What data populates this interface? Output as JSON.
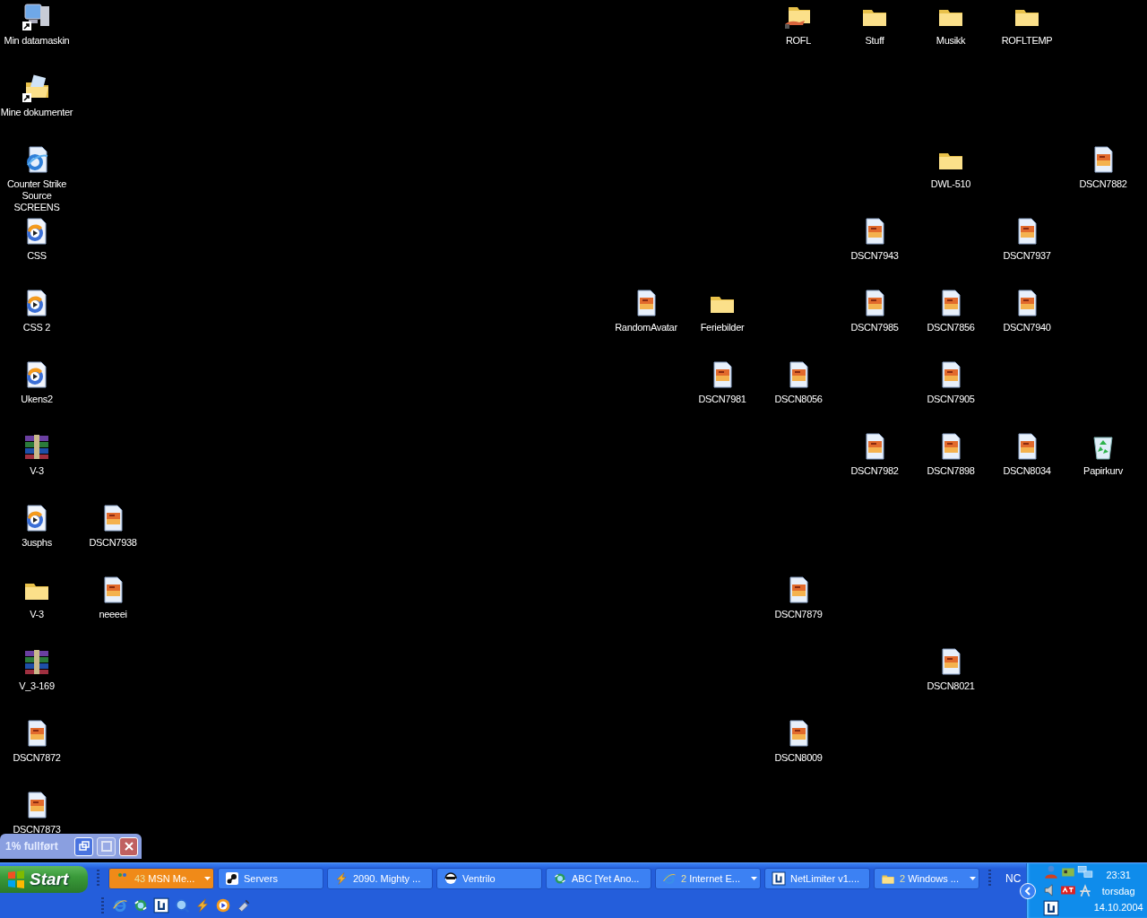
{
  "desktop_icons": [
    {
      "label": "Min datamaskin",
      "kind": "computer",
      "shortcut": true
    },
    {
      "label": "ROFL",
      "kind": "shared-folder",
      "shortcut": false
    },
    {
      "label": "Stuff",
      "kind": "folder",
      "shortcut": false
    },
    {
      "label": "Musikk",
      "kind": "folder",
      "shortcut": false
    },
    {
      "label": "ROFLTEMP",
      "kind": "folder",
      "shortcut": false
    },
    {
      "label": "Mine dokumenter",
      "kind": "documents",
      "shortcut": true
    },
    {
      "label": "Counter Strike Source SCREENS",
      "kind": "web",
      "shortcut": false
    },
    {
      "label": "DWL-510",
      "kind": "folder",
      "shortcut": false
    },
    {
      "label": "DSCN7882",
      "kind": "image",
      "shortcut": false
    },
    {
      "label": "CSS",
      "kind": "media",
      "shortcut": false
    },
    {
      "label": "DSCN7943",
      "kind": "image",
      "shortcut": false
    },
    {
      "label": "DSCN7937",
      "kind": "image",
      "shortcut": false
    },
    {
      "label": "CSS 2",
      "kind": "media",
      "shortcut": false
    },
    {
      "label": "RandomAvatar",
      "kind": "image",
      "shortcut": false
    },
    {
      "label": "Feriebilder",
      "kind": "folder",
      "shortcut": false
    },
    {
      "label": "DSCN7985",
      "kind": "image",
      "shortcut": false
    },
    {
      "label": "DSCN7856",
      "kind": "image",
      "shortcut": false
    },
    {
      "label": "DSCN7940",
      "kind": "image",
      "shortcut": false
    },
    {
      "label": "Ukens2",
      "kind": "media",
      "shortcut": false
    },
    {
      "label": "DSCN7981",
      "kind": "image",
      "shortcut": false
    },
    {
      "label": "DSCN8056",
      "kind": "image",
      "shortcut": false
    },
    {
      "label": "DSCN7905",
      "kind": "image",
      "shortcut": false
    },
    {
      "label": "V-3",
      "kind": "archive",
      "shortcut": false
    },
    {
      "label": "DSCN7982",
      "kind": "image",
      "shortcut": false
    },
    {
      "label": "DSCN7898",
      "kind": "image",
      "shortcut": false
    },
    {
      "label": "DSCN8034",
      "kind": "image",
      "shortcut": false
    },
    {
      "label": "Papirkurv",
      "kind": "recycle",
      "shortcut": false
    },
    {
      "label": "3usphs",
      "kind": "media",
      "shortcut": false
    },
    {
      "label": "DSCN7938",
      "kind": "image",
      "shortcut": false
    },
    {
      "label": "V-3",
      "kind": "folder",
      "shortcut": false
    },
    {
      "label": "neeeei",
      "kind": "image",
      "shortcut": false
    },
    {
      "label": "DSCN7879",
      "kind": "image",
      "shortcut": false
    },
    {
      "label": "V_3-169",
      "kind": "archive",
      "shortcut": false
    },
    {
      "label": "DSCN8021",
      "kind": "image",
      "shortcut": false
    },
    {
      "label": "DSCN7872",
      "kind": "image",
      "shortcut": false
    },
    {
      "label": "DSCN8009",
      "kind": "image",
      "shortcut": false
    },
    {
      "label": "DSCN7873",
      "kind": "image",
      "shortcut": false
    }
  ],
  "progress_window": {
    "title": "1% fullført",
    "buttons": [
      {
        "kind": "restore",
        "disabled": false
      },
      {
        "kind": "maximize",
        "disabled": true
      },
      {
        "kind": "close",
        "disabled": false
      }
    ]
  },
  "taskbar": {
    "start": "Start",
    "tasks": [
      {
        "count": "43",
        "label": "MSN Me...",
        "flashing": true,
        "grouped": true
      },
      {
        "label": "Servers",
        "flashing": false,
        "grouped": false
      },
      {
        "label": "2090. Mighty ...",
        "flashing": false,
        "grouped": false
      },
      {
        "label": "Ventrilo",
        "flashing": false,
        "grouped": false
      },
      {
        "label": "ABC [Yet Ano...",
        "flashing": false,
        "grouped": false
      },
      {
        "count": "2",
        "label": "Internet E...",
        "flashing": false,
        "grouped": true
      },
      {
        "label": "NetLimiter v1....",
        "flashing": false,
        "grouped": false
      },
      {
        "count": "2",
        "label": "Windows ...",
        "flashing": false,
        "grouped": true
      }
    ],
    "toolbar": "NC",
    "clock": {
      "time": "23:31",
      "day": "torsdag",
      "date": "14.10.2004"
    }
  }
}
